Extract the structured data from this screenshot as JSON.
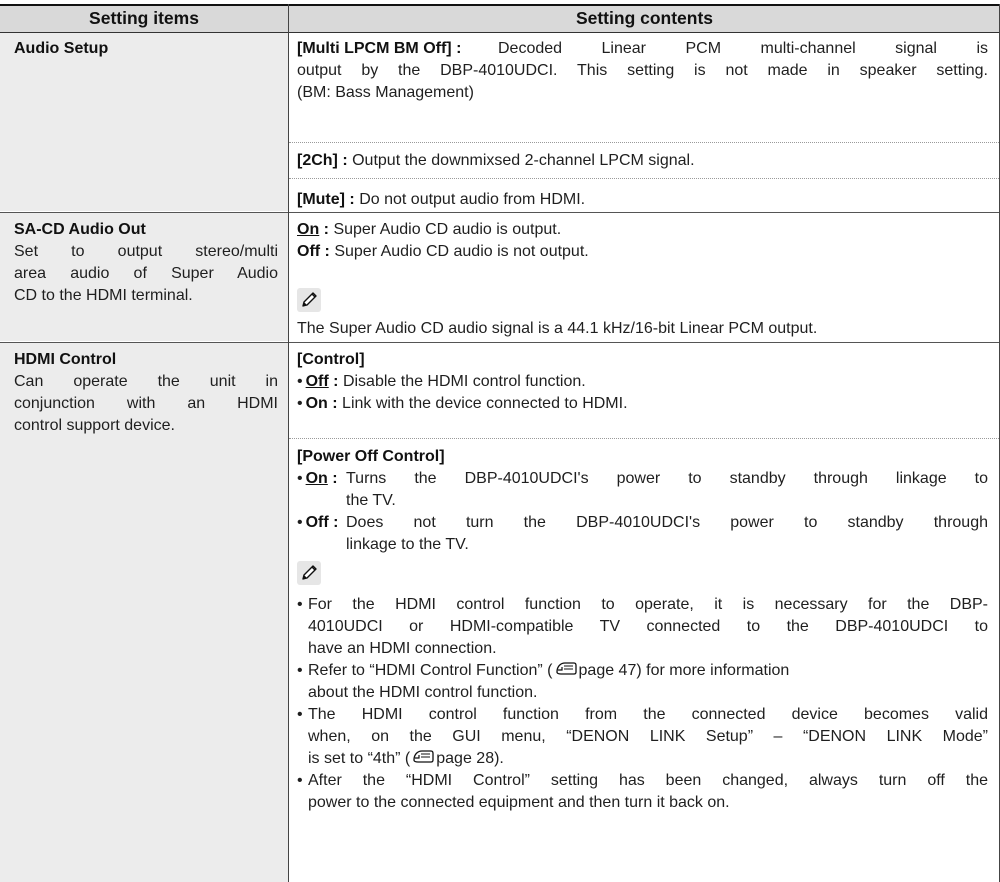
{
  "table": {
    "headers": {
      "items": "Setting items",
      "contents": "Setting contents"
    },
    "audio_setup": {
      "title": "Audio Setup",
      "multi_label": "[Multi LPCM BM Off]",
      "colon": " : ",
      "multi_l1": "Decoded Linear PCM multi-channel signal is",
      "multi_l2": "output by the DBP-4010UDCI. This setting is not made in speaker setting.",
      "multi_l3": "(BM: Bass Management)",
      "ch2_label": "[2Ch]",
      "ch2_text": "Output the downmixsed 2-channel LPCM signal.",
      "mute_label": "[Mute]",
      "mute_text": "Do not output audio from HDMI."
    },
    "sacd": {
      "title": "SA-CD Audio Out",
      "desc_l1": "Set to output stereo/multi",
      "desc_l2": "area audio of Super Audio",
      "desc_l3": "CD to the HDMI terminal.",
      "on_label": "On",
      "on_text": "Super Audio CD audio is output.",
      "off_label": "Off",
      "off_text": "Super Audio CD audio is not output.",
      "note": "The Super Audio CD audio signal is a 44.1 kHz/16-bit Linear PCM output."
    },
    "hdmi": {
      "title": "HDMI Control",
      "desc_l1": "Can operate the unit in",
      "desc_l2": "conjunction with an HDMI",
      "desc_l3": "control support device.",
      "control_label": "[Control]",
      "c_off_label": "Off",
      "c_off_text": "Disable the HDMI control function.",
      "c_on_label": "On",
      "c_on_text": "Link with the device connected to HDMI.",
      "power_label": "[Power Off Control]",
      "p_on_label": "On",
      "p_on_l1": "Turns the DBP-4010UDCI's power to standby through linkage to",
      "p_on_l2": "the TV.",
      "p_off_label": "Off",
      "p_off_l1": "Does not turn the DBP-4010UDCI's power to standby through",
      "p_off_l2": "linkage to the TV.",
      "n1_l1": "For the HDMI control function to operate, it is necessary for the DBP-",
      "n1_l2": "4010UDCI or HDMI-compatible TV connected to the DBP-4010UDCI to",
      "n1_l3": "have an HDMI connection.",
      "n2_l1_a": "Refer to “HDMI Control Function” (",
      "n2_l1_b": "page 47) for more information",
      "n2_l2": "about the HDMI control function.",
      "n3_l1": "The HDMI control function from the connected device becomes valid",
      "n3_l2": "when, on the GUI menu, “DENON LINK Setup” – “DENON LINK Mode”",
      "n3_l3_a": "is set to “4th” (",
      "n3_l3_b": "page 28).",
      "n4_l1": "After the “HDMI Control” setting has been changed, always turn off the",
      "n4_l2": "power to the connected equipment and then turn it back on."
    },
    "bullet": "•",
    "colon_short": " :",
    "colon_space": " : "
  }
}
